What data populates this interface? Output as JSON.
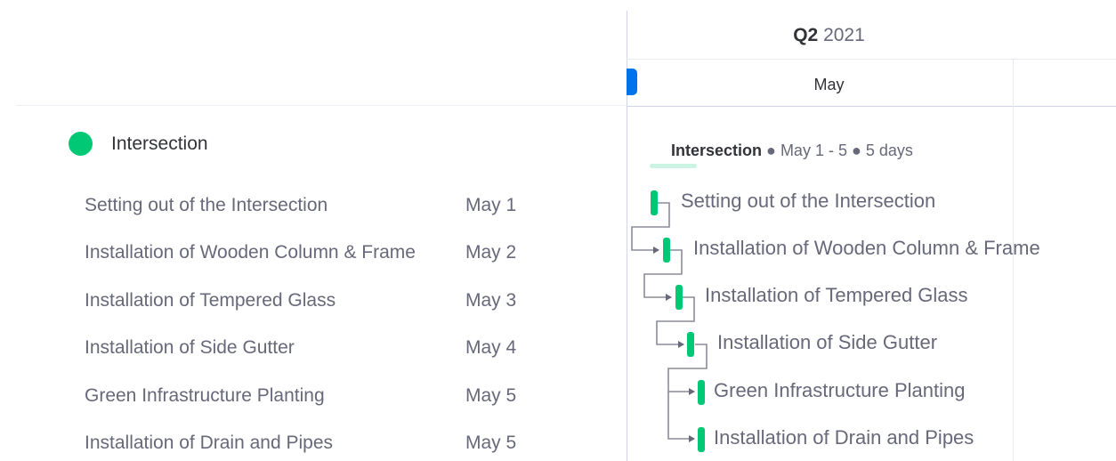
{
  "group": {
    "name": "Intersection",
    "color": "#00c875",
    "summary_range": "May 1 - 5",
    "summary_duration": "5 days",
    "summary_separator": "●"
  },
  "tasks": [
    {
      "name": "Setting out of the Intersection",
      "date": "May 1"
    },
    {
      "name": "Installation of Wooden Column & Frame",
      "date": "May 2"
    },
    {
      "name": "Installation of Tempered Glass",
      "date": "May 3"
    },
    {
      "name": "Installation of Side Gutter",
      "date": "May 4"
    },
    {
      "name": "Green Infrastructure Planting",
      "date": "May 5"
    },
    {
      "name": "Installation of Drain and Pipes",
      "date": "May 5"
    }
  ],
  "timeline": {
    "quarter": "Q2",
    "year": "2021",
    "month": "May",
    "today_color": "#0073ea",
    "bar_color": "#00c875"
  }
}
